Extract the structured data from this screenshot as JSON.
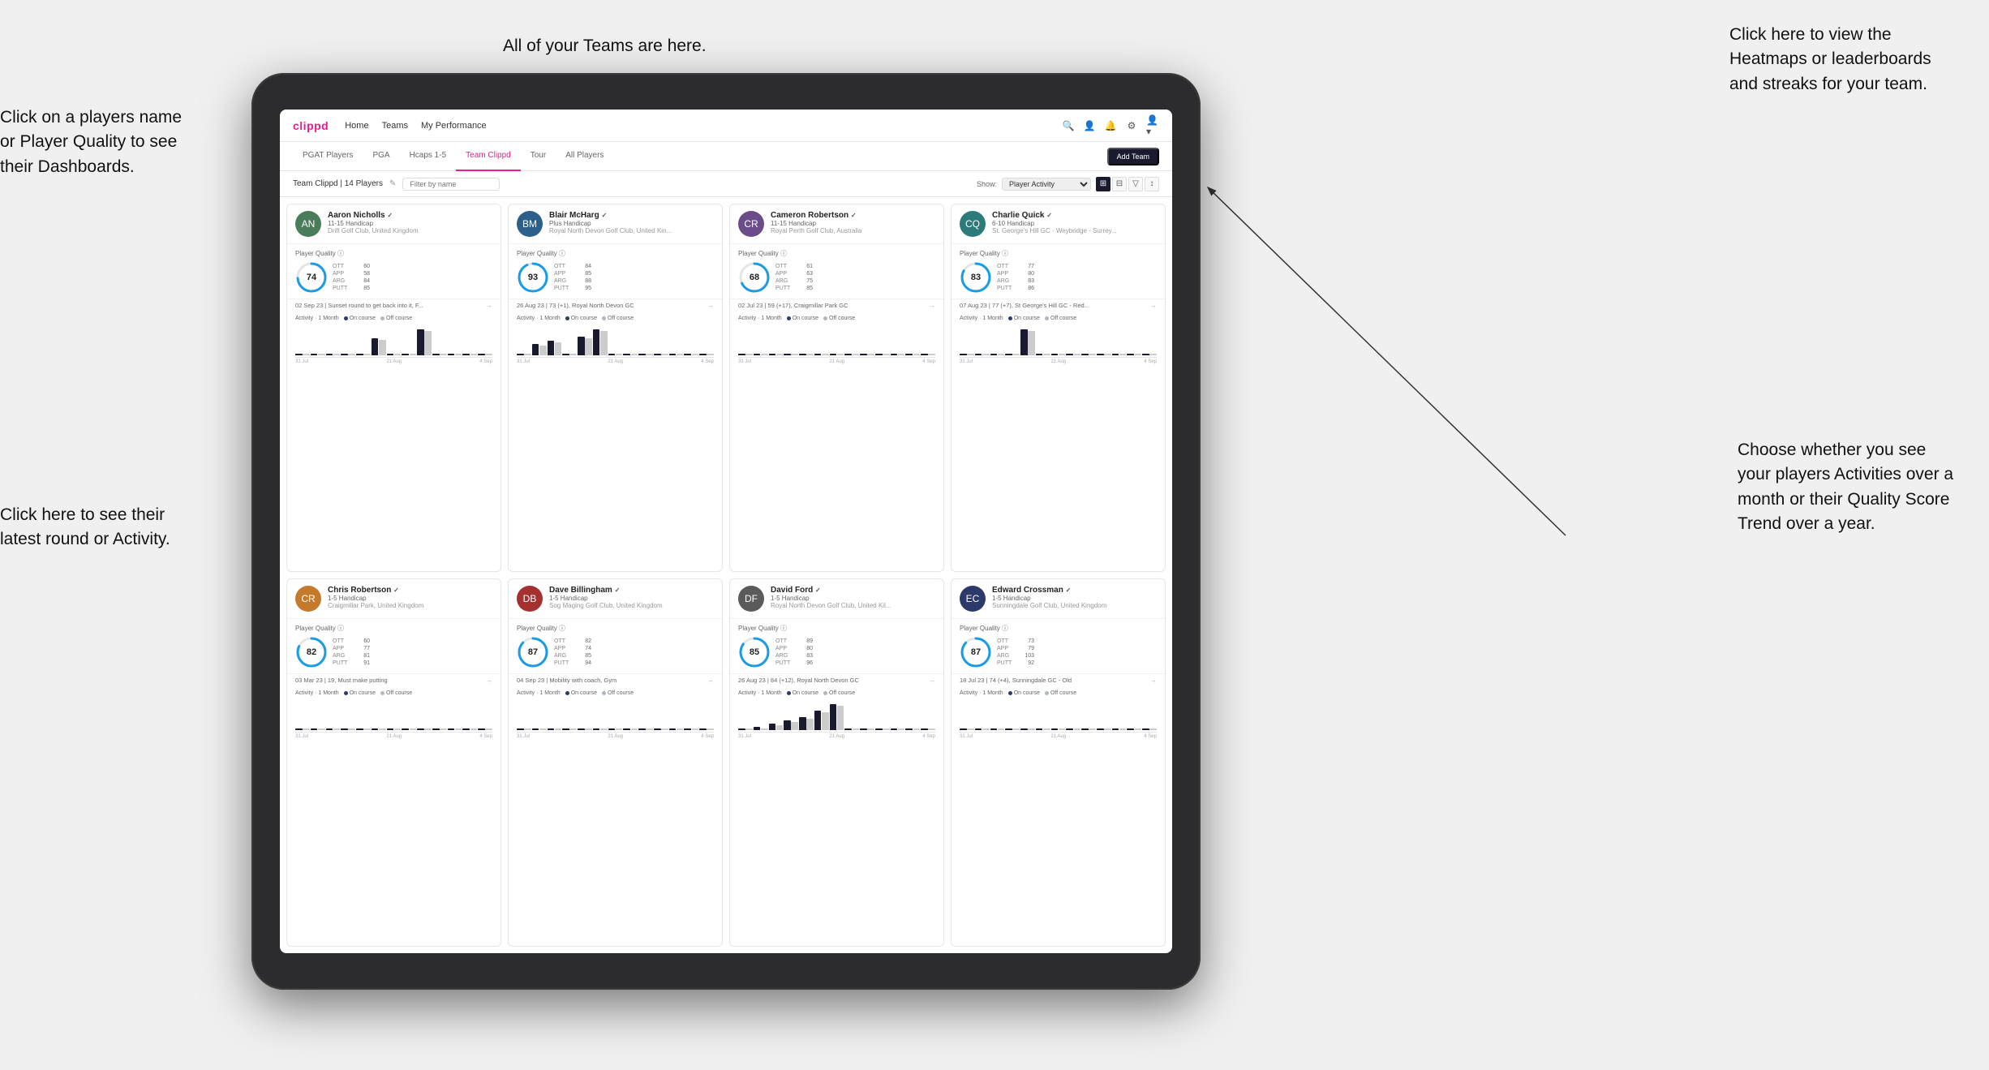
{
  "annotations": {
    "top_center": "All of your Teams are here.",
    "top_right": "Click here to view the\nHeatmaps or leaderboards\nand streaks for your team.",
    "left_top": "Click on a players name\nor Player Quality to see\ntheir Dashboards.",
    "left_bottom": "Click here to see their latest\nround or Activity.",
    "right_bottom": "Choose whether you see\nyour players Activities over\na month or their Quality\nScore Trend over a year."
  },
  "nav": {
    "logo": "clippd",
    "links": [
      "Home",
      "Teams",
      "My Performance"
    ],
    "tabs": [
      "PGAT Players",
      "PGA",
      "Hcaps 1-5",
      "Team Clippd",
      "Tour",
      "All Players"
    ],
    "active_tab": "Team Clippd",
    "add_team": "Add Team",
    "team_label": "Team Clippd | 14 Players",
    "filter_placeholder": "Filter by name",
    "show_label": "Show:",
    "show_option": "Player Activity"
  },
  "players": [
    {
      "name": "Aaron Nicholls",
      "handicap": "11-15 Handicap",
      "club": "Drift Golf Club, United Kingdom",
      "quality": 74,
      "ott": 60,
      "app": 58,
      "arg": 84,
      "putt": 85,
      "latest_round": "02 Sep 23 | Sunset round to get back into it, F...",
      "bars": [
        0,
        0,
        0,
        0,
        0,
        2,
        0,
        0,
        3,
        0,
        0,
        0,
        0
      ],
      "initials": "AN",
      "av_color": "av-green"
    },
    {
      "name": "Blair McHarg",
      "handicap": "Plus Handicap",
      "club": "Royal North Devon Golf Club, United Kin...",
      "quality": 93,
      "ott": 84,
      "app": 85,
      "arg": 88,
      "putt": 95,
      "latest_round": "26 Aug 23 | 73 (+1), Royal North Devon GC",
      "bars": [
        0,
        3,
        4,
        0,
        5,
        7,
        0,
        0,
        0,
        0,
        0,
        0,
        0
      ],
      "initials": "BM",
      "av_color": "av-blue"
    },
    {
      "name": "Cameron Robertson",
      "handicap": "11-15 Handicap",
      "club": "Royal Perth Golf Club, Australia",
      "quality": 68,
      "ott": 61,
      "app": 63,
      "arg": 75,
      "putt": 85,
      "latest_round": "02 Jul 23 | 59 (+17), Craigmillar Park GC",
      "bars": [
        0,
        0,
        0,
        0,
        0,
        0,
        0,
        0,
        0,
        0,
        0,
        0,
        0
      ],
      "initials": "CR",
      "av_color": "av-purple"
    },
    {
      "name": "Charlie Quick",
      "handicap": "6-10 Handicap",
      "club": "St. George's Hill GC - Weybridge - Surrey...",
      "quality": 83,
      "ott": 77,
      "app": 80,
      "arg": 83,
      "putt": 86,
      "latest_round": "07 Aug 23 | 77 (+7), St George's Hill GC - Red...",
      "bars": [
        0,
        0,
        0,
        0,
        2,
        0,
        0,
        0,
        0,
        0,
        0,
        0,
        0
      ],
      "initials": "CQ",
      "av_color": "av-teal"
    },
    {
      "name": "Chris Robertson",
      "handicap": "1-5 Handicap",
      "club": "Craigmillar Park, United Kingdom",
      "quality": 82,
      "ott": 60,
      "app": 77,
      "arg": 81,
      "putt": 91,
      "latest_round": "03 Mar 23 | 19, Must make putting",
      "bars": [
        0,
        0,
        0,
        0,
        0,
        0,
        0,
        0,
        0,
        0,
        0,
        0,
        0
      ],
      "initials": "CR2",
      "av_color": "av-orange"
    },
    {
      "name": "Dave Billingham",
      "handicap": "1-5 Handicap",
      "club": "Sog Maging Golf Club, United Kingdom",
      "quality": 87,
      "ott": 82,
      "app": 74,
      "arg": 85,
      "putt": 94,
      "latest_round": "04 Sep 23 | Mobility with coach, Gym",
      "bars": [
        0,
        0,
        0,
        0,
        0,
        0,
        0,
        0,
        0,
        0,
        0,
        0,
        0
      ],
      "initials": "DB",
      "av_color": "av-red"
    },
    {
      "name": "David Ford",
      "handicap": "1-5 Handicap",
      "club": "Royal North Devon Golf Club, United Kil...",
      "quality": 85,
      "ott": 89,
      "app": 80,
      "arg": 83,
      "putt": 96,
      "latest_round": "26 Aug 23 | 84 (+12), Royal North Devon GC",
      "bars": [
        0,
        1,
        2,
        3,
        4,
        6,
        8,
        0,
        0,
        0,
        0,
        0,
        0
      ],
      "initials": "DF",
      "av_color": "av-gray"
    },
    {
      "name": "Edward Crossman",
      "handicap": "1-5 Handicap",
      "club": "Sunningdale Golf Club, United Kingdom",
      "quality": 87,
      "ott": 73,
      "app": 79,
      "arg": 103,
      "putt": 92,
      "latest_round": "18 Jul 23 | 74 (+4), Sunningdale GC - Old",
      "bars": [
        0,
        0,
        0,
        0,
        0,
        0,
        0,
        0,
        0,
        0,
        0,
        0,
        0
      ],
      "initials": "EC",
      "av_color": "av-navy"
    }
  ],
  "bar_colors": {
    "ott": "#f5a623",
    "app": "#7ed321",
    "arg": "#e91e8c",
    "putt": "#9b59b6"
  },
  "chart": {
    "dates": [
      "31 Jul",
      "21 Aug",
      "4 Sep"
    ],
    "on_course_color": "#2c3a6b",
    "off_course_color": "#b0b8c1"
  }
}
